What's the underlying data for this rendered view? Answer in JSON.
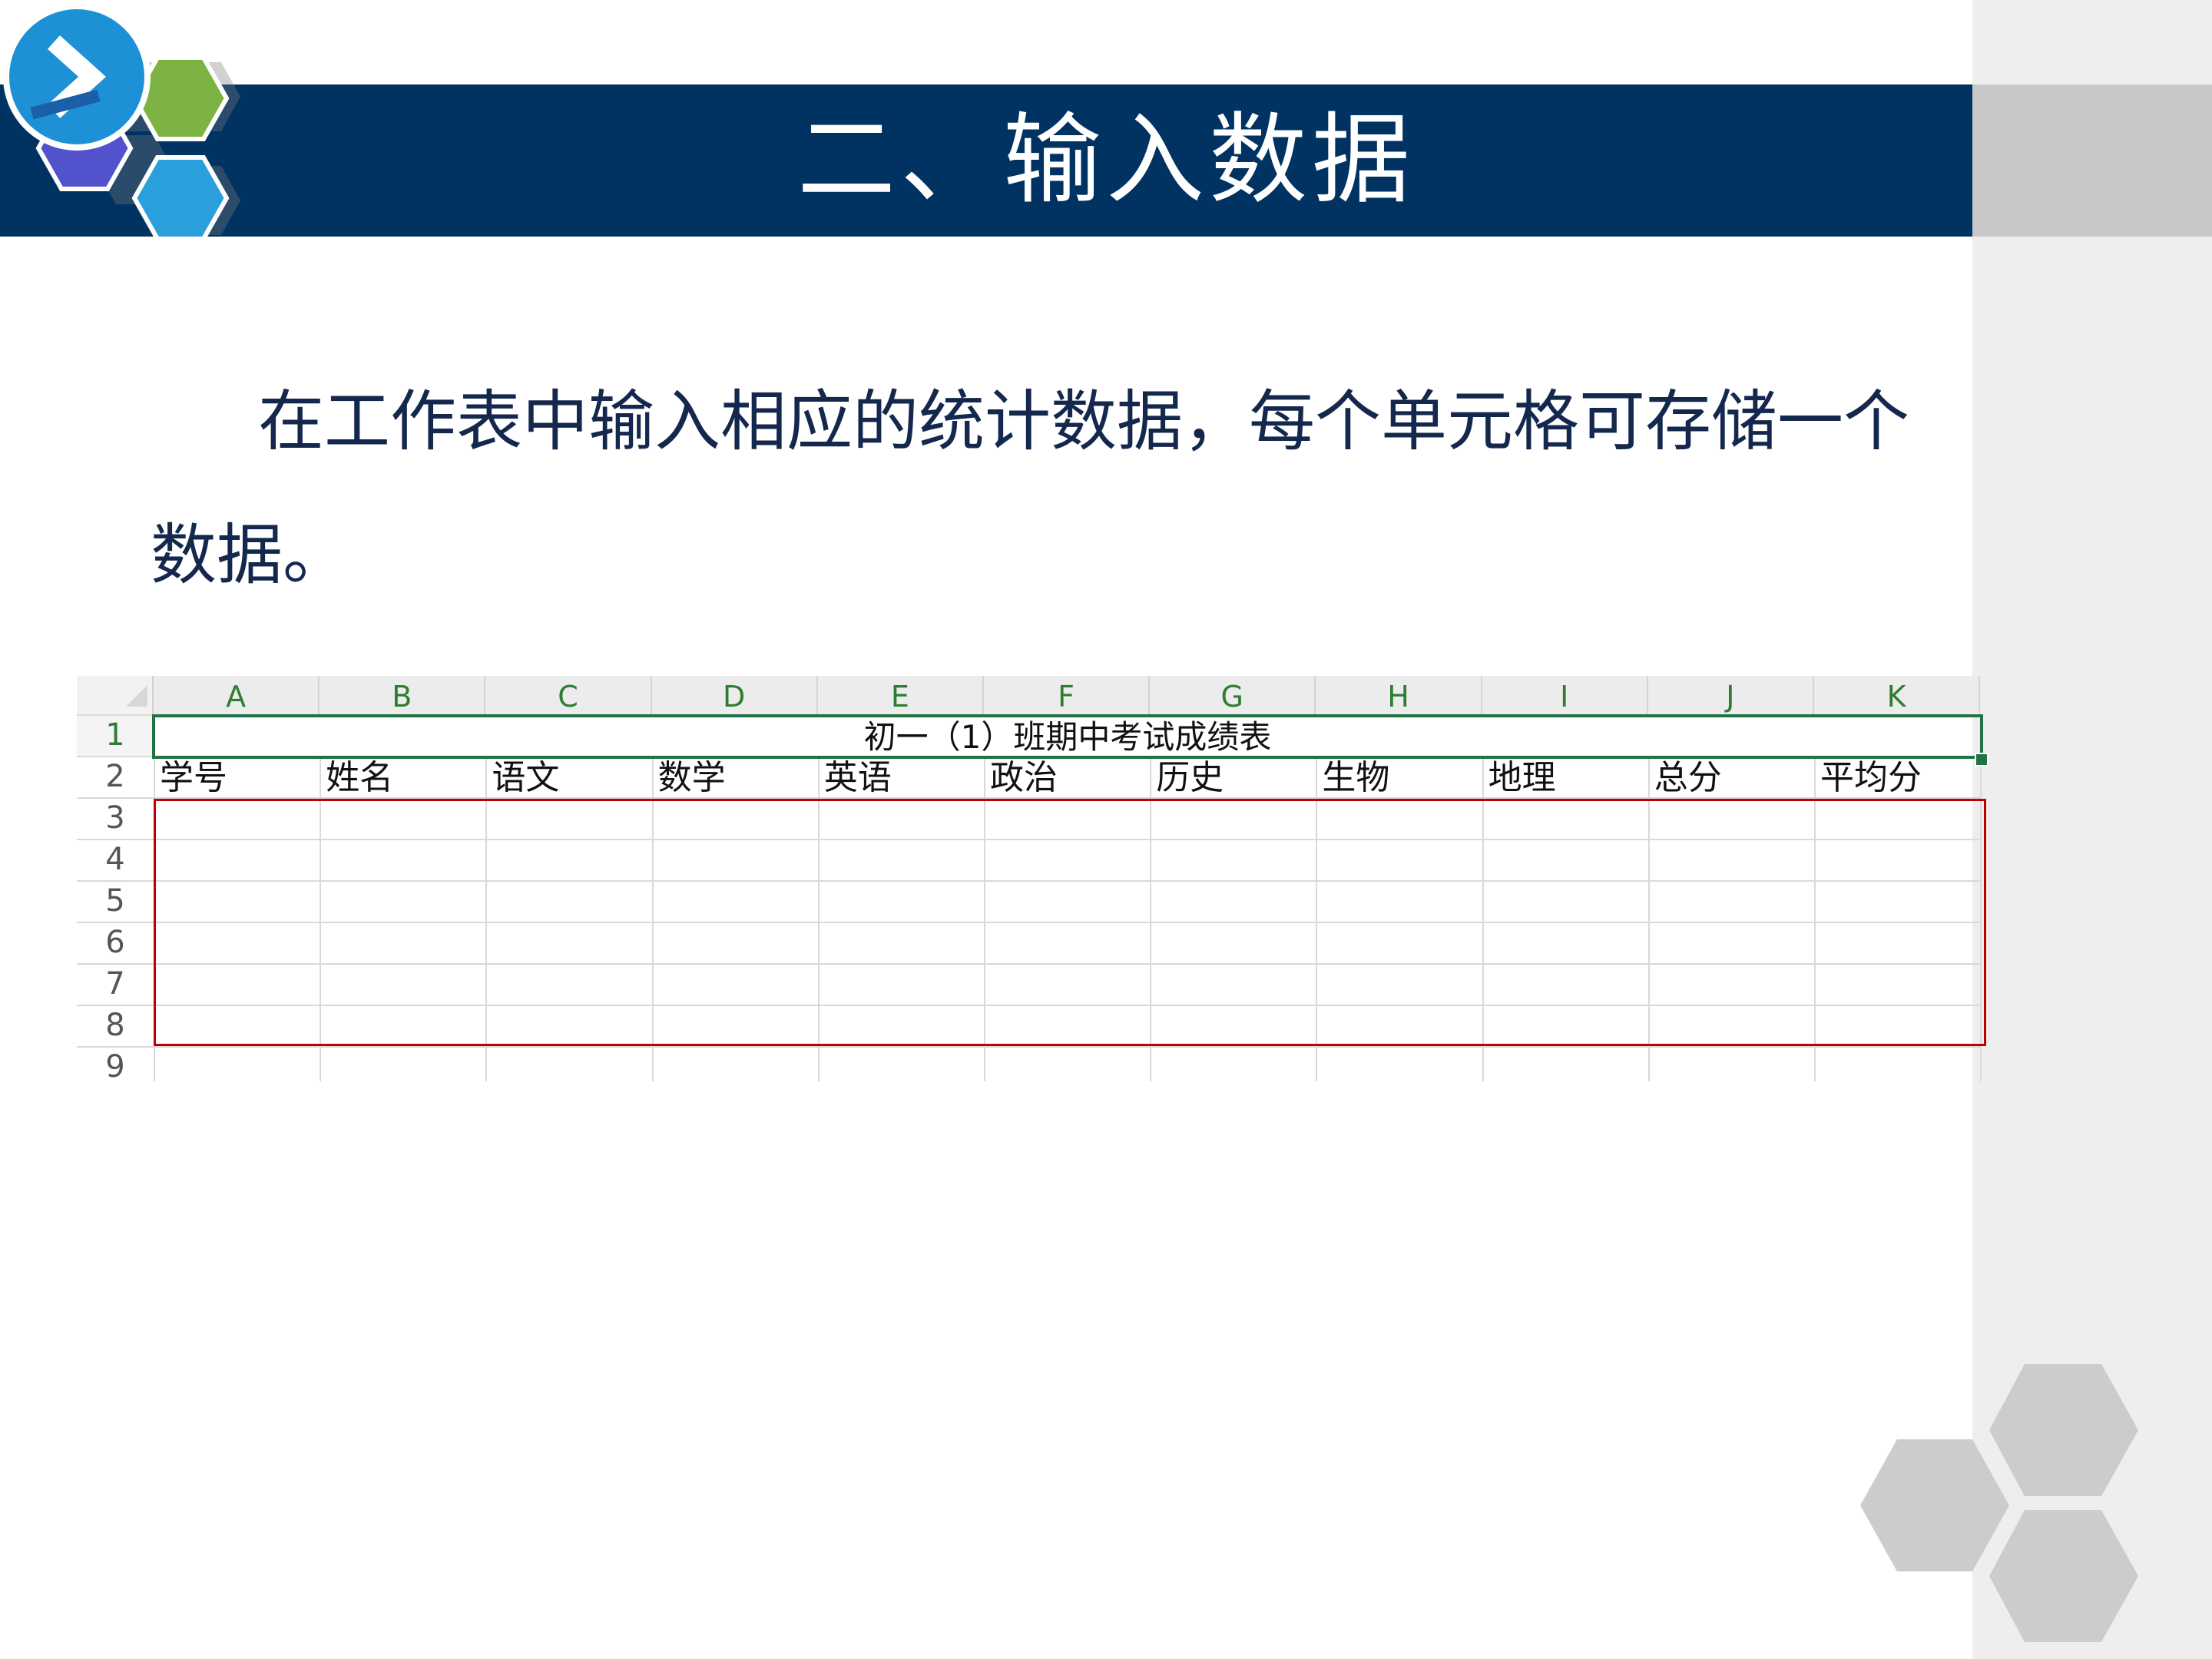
{
  "slide": {
    "title": "二、输入数据",
    "body": "在工作表中输入相应的统计数据，每个单元格可存储一个数据。"
  },
  "colors": {
    "title_bar": "#003361",
    "body_text": "#14284e",
    "selection_green": "#217346",
    "selection_red": "#c00000",
    "header_text_green": "#2e7d32"
  },
  "spreadsheet": {
    "columns": [
      "A",
      "B",
      "C",
      "D",
      "E",
      "F",
      "G",
      "H",
      "I",
      "J",
      "K"
    ],
    "rows": [
      "1",
      "2",
      "3",
      "4",
      "5",
      "6",
      "7",
      "8",
      "9"
    ],
    "merged_title": "初一（1）班期中考试成绩表",
    "header_cells": [
      "学号",
      "姓名",
      "语文",
      "数学",
      "英语",
      "政治",
      "历史",
      "生物",
      "地理",
      "总分",
      "平均分"
    ]
  }
}
